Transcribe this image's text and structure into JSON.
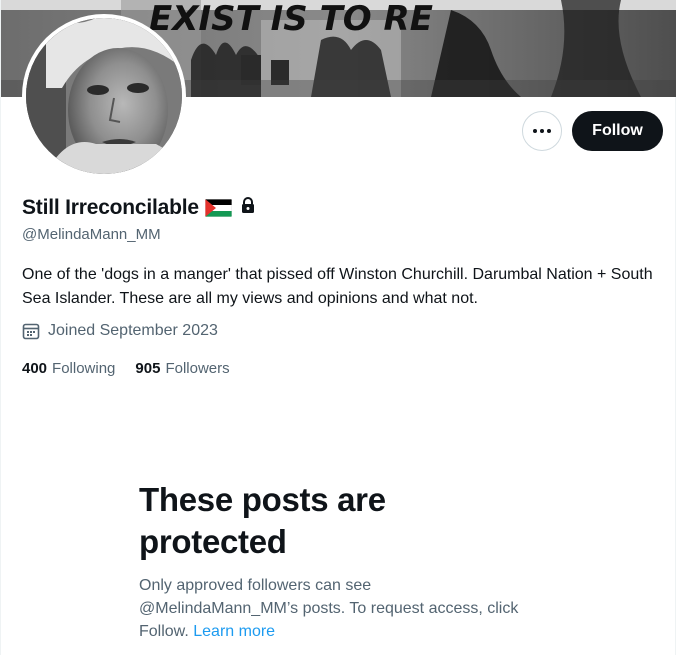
{
  "banner": {
    "graffiti_text": "EXIST IS TO RE"
  },
  "actions": {
    "more_icon": "ellipsis-icon",
    "follow_label": "Follow"
  },
  "profile": {
    "display_name": "Still Irreconcilable",
    "flag_icon": "palestine-flag-icon",
    "lock_icon": "lock-icon",
    "handle": "@MelindaMann_MM",
    "bio": "One of the 'dogs in a manger' that pissed off Winston Churchill. Darumbal Nation + South Sea Islander. These are all my views and opinions and what not.",
    "joined_icon": "calendar-icon",
    "joined": "Joined September 2023",
    "following_count": "400",
    "following_label": "Following",
    "followers_count": "905",
    "followers_label": "Followers"
  },
  "protected": {
    "title": "These posts are protected",
    "text_before": "Only approved followers can see @MelindaMann_MM’s posts. To request access, click Follow.",
    "learn_more": "Learn more"
  },
  "colors": {
    "primary_text": "#0f1419",
    "secondary_text": "#536471",
    "link": "#1d9bf0",
    "button_dark": "#0f1419"
  }
}
